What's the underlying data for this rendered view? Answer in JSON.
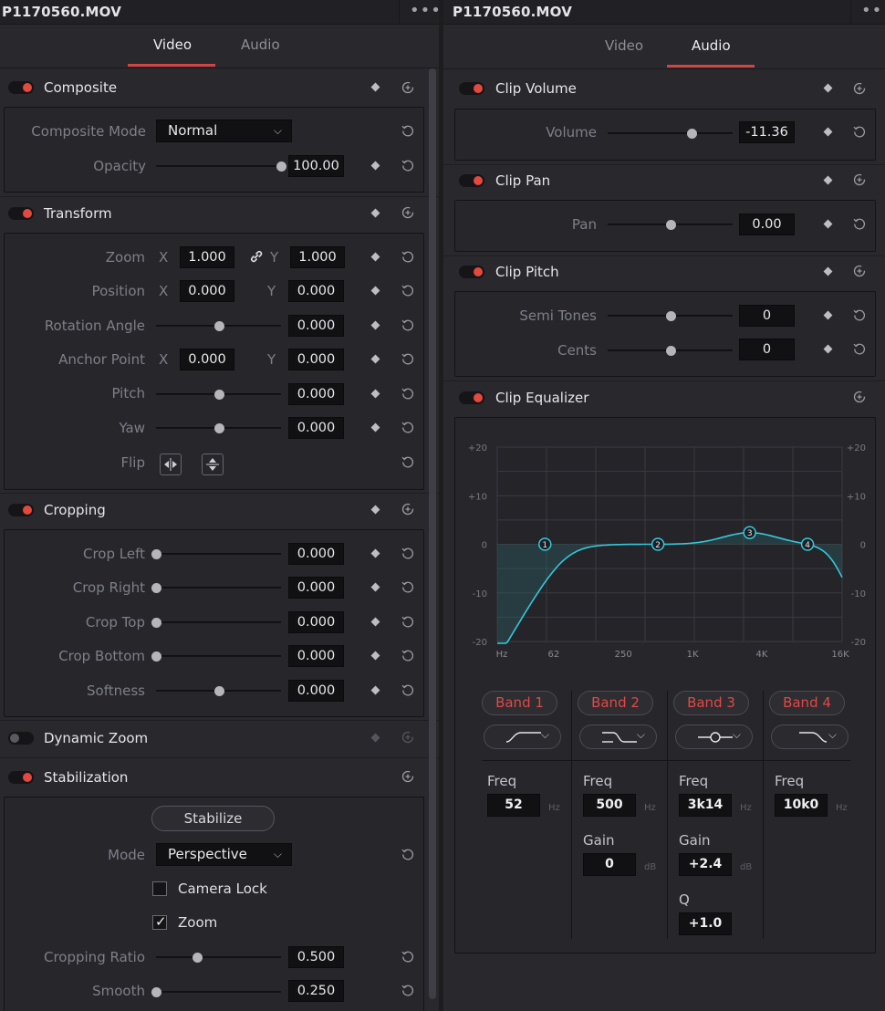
{
  "left_panel": {
    "title": "P1170560.MOV",
    "menu": "•••",
    "tabs": [
      {
        "label": "Video",
        "active": true
      },
      {
        "label": "Audio",
        "active": false
      }
    ],
    "composite": {
      "title": "Composite",
      "mode_label": "Composite Mode",
      "mode_value": "Normal",
      "opacity_label": "Opacity",
      "opacity_value": "100.00",
      "opacity_pos": 1.0
    },
    "transform": {
      "title": "Transform",
      "zoom": {
        "label": "Zoom",
        "x_axis": "X",
        "x": "1.000",
        "y_axis": "Y",
        "y": "1.000"
      },
      "position": {
        "label": "Position",
        "x_axis": "X",
        "x": "0.000",
        "y_axis": "Y",
        "y": "0.000"
      },
      "rotation": {
        "label": "Rotation Angle",
        "value": "0.000",
        "pos": 0.5
      },
      "anchor": {
        "label": "Anchor Point",
        "x_axis": "X",
        "x": "0.000",
        "y_axis": "Y",
        "y": "0.000"
      },
      "pitch": {
        "label": "Pitch",
        "value": "0.000",
        "pos": 0.5
      },
      "yaw": {
        "label": "Yaw",
        "value": "0.000",
        "pos": 0.5
      },
      "flip_label": "Flip"
    },
    "cropping": {
      "title": "Cropping",
      "rows": [
        {
          "label": "Crop Left",
          "value": "0.000",
          "pos": 0.0
        },
        {
          "label": "Crop Right",
          "value": "0.000",
          "pos": 0.0
        },
        {
          "label": "Crop Top",
          "value": "0.000",
          "pos": 0.0
        },
        {
          "label": "Crop Bottom",
          "value": "0.000",
          "pos": 0.0
        },
        {
          "label": "Softness",
          "value": "0.000",
          "pos": 0.5
        }
      ]
    },
    "dynamic_zoom": {
      "title": "Dynamic Zoom"
    },
    "stabilization": {
      "title": "Stabilization",
      "stabilize_button": "Stabilize",
      "mode_label": "Mode",
      "mode_value": "Perspective",
      "camera_lock": {
        "label": "Camera Lock",
        "checked": false
      },
      "zoom": {
        "label": "Zoom",
        "checked": true,
        "mark": "✓"
      },
      "cropping_ratio": {
        "label": "Cropping Ratio",
        "value": "0.500",
        "pos": 0.33
      },
      "smooth": {
        "label": "Smooth",
        "value": "0.250",
        "pos": 0.0
      }
    }
  },
  "right_panel": {
    "title": "P1170560.MOV",
    "menu": "•••",
    "tabs": [
      {
        "label": "Video",
        "active": false
      },
      {
        "label": "Audio",
        "active": true
      }
    ],
    "clip_volume": {
      "title": "Clip Volume",
      "label": "Volume",
      "value": "-11.36",
      "pos": 0.67
    },
    "clip_pan": {
      "title": "Clip Pan",
      "label": "Pan",
      "value": "0.00",
      "pos": 0.5
    },
    "clip_pitch": {
      "title": "Clip Pitch",
      "semitones": {
        "label": "Semi Tones",
        "value": "0",
        "pos": 0.5
      },
      "cents": {
        "label": "Cents",
        "value": "0",
        "pos": 0.5
      }
    },
    "clip_equalizer": {
      "title": "Clip Equalizer",
      "y_ticks": [
        "+20",
        "+10",
        "0",
        "-10",
        "-20"
      ],
      "x_ticks": [
        "Hz",
        "62",
        "250",
        "1K",
        "4K",
        "16K"
      ],
      "nodes": [
        {
          "id": "1",
          "freq_hz": 52,
          "gain_db": 0
        },
        {
          "id": "2",
          "freq_hz": 500,
          "gain_db": 0
        },
        {
          "id": "3",
          "freq_hz": 3140,
          "gain_db": 2.4
        },
        {
          "id": "4",
          "freq_hz": 10000,
          "gain_db": 0
        }
      ],
      "bands": [
        {
          "label": "Band 1",
          "shape": "high-pass-icon",
          "freq_label": "Freq",
          "freq": "52",
          "freq_unit": "Hz"
        },
        {
          "label": "Band 2",
          "shape": "low-shelf-icon",
          "freq_label": "Freq",
          "freq": "500",
          "freq_unit": "Hz",
          "gain_label": "Gain",
          "gain": "0",
          "gain_unit": "dB"
        },
        {
          "label": "Band 3",
          "shape": "bell-icon",
          "freq_label": "Freq",
          "freq": "3k14",
          "freq_unit": "Hz",
          "gain_label": "Gain",
          "gain": "+2.4",
          "gain_unit": "dB",
          "q_label": "Q",
          "q": "+1.0"
        },
        {
          "label": "Band 4",
          "shape": "low-pass-icon",
          "freq_label": "Freq",
          "freq": "10k0",
          "freq_unit": "Hz"
        }
      ]
    }
  },
  "colors": {
    "accent": "#e5483d",
    "curve": "#33c9dc",
    "background": "#28282d"
  }
}
